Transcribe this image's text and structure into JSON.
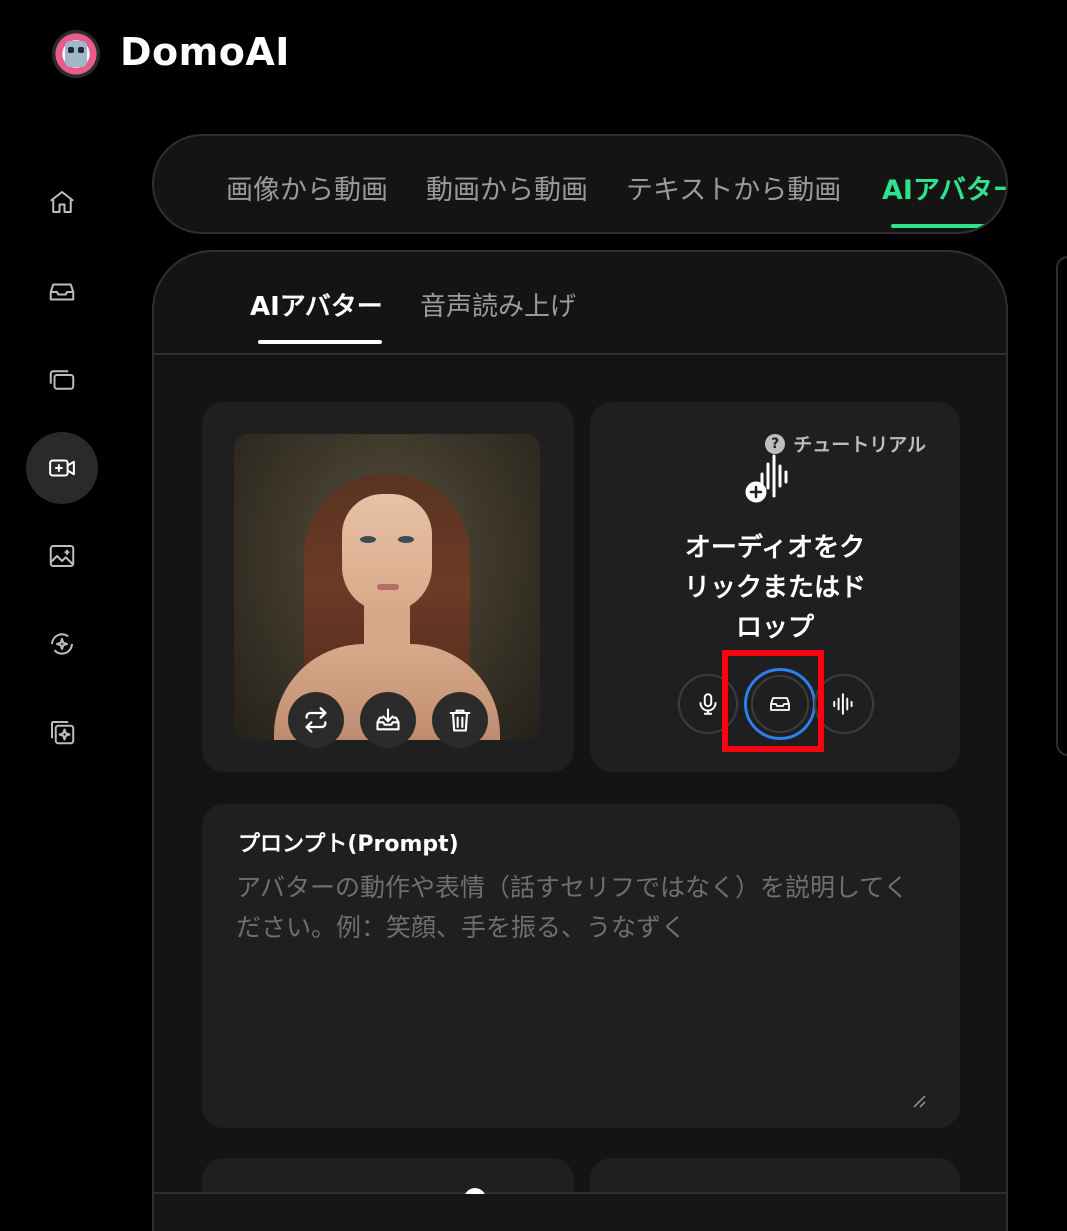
{
  "app": {
    "title": "DomoAI"
  },
  "sidebar": {
    "items": [
      {
        "name": "home",
        "icon": "home-icon"
      },
      {
        "name": "inbox",
        "icon": "inbox-tray-icon"
      },
      {
        "name": "library",
        "icon": "stacked-cards-icon"
      },
      {
        "name": "video",
        "icon": "video-plus-icon",
        "active": true
      },
      {
        "name": "image",
        "icon": "image-plus-icon"
      },
      {
        "name": "effects",
        "icon": "sparkle-refresh-icon"
      },
      {
        "name": "tools",
        "icon": "layers-sparkle-icon"
      }
    ]
  },
  "mode_tabs": {
    "items": [
      "画像から動画",
      "動画から動画",
      "テキストから動画",
      "AIアバター"
    ],
    "active_index": 3,
    "accent_color": "#2ee38a"
  },
  "sub_tabs": {
    "items": [
      "AIアバター",
      "音声読み上げ"
    ],
    "active_index": 0
  },
  "avatar_card": {
    "actions": [
      {
        "name": "replace",
        "icon": "swap-arrows-icon"
      },
      {
        "name": "download",
        "icon": "download-tray-icon"
      },
      {
        "name": "delete",
        "icon": "trash-icon"
      }
    ]
  },
  "audio_card": {
    "tutorial_label": "チュートリアル",
    "tutorial_badge": "?",
    "drop_text_line1": "オーディオをク",
    "drop_text_line2": "リックまたはド",
    "drop_text_line3": "ロップ",
    "buttons": [
      {
        "name": "record",
        "icon": "microphone-icon"
      },
      {
        "name": "upload",
        "icon": "inbox-tray-icon",
        "focused": true
      },
      {
        "name": "voice-library",
        "icon": "waveform-icon"
      }
    ],
    "focus_ring_color": "#2d7ff0",
    "highlight_color": "#ff0010"
  },
  "prompt": {
    "label": "プロンプト(Prompt)",
    "value": "",
    "placeholder": "アバターの動作や表情（話すセリフではなく）を説明してください。例：笑顔、手を振る、うなずく"
  }
}
